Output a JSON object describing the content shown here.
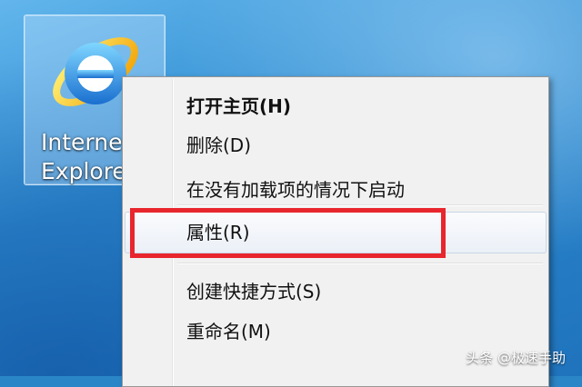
{
  "desktop_icon": {
    "label_line1": "Interne",
    "label_line2": "Explore",
    "icon": "internet-explorer-icon"
  },
  "context_menu": {
    "items": [
      {
        "label": "打开主页(H)",
        "bold": true
      },
      {
        "label": "删除(D)"
      },
      {
        "label": "在没有加载项的情况下启动"
      },
      {
        "label": "属性(R)",
        "highlighted": true
      },
      {
        "label": "创建快捷方式(S)"
      },
      {
        "label": "重命名(M)"
      }
    ]
  },
  "annotation": {
    "color": "#e8262d"
  },
  "watermark": "头条 @极速手助"
}
